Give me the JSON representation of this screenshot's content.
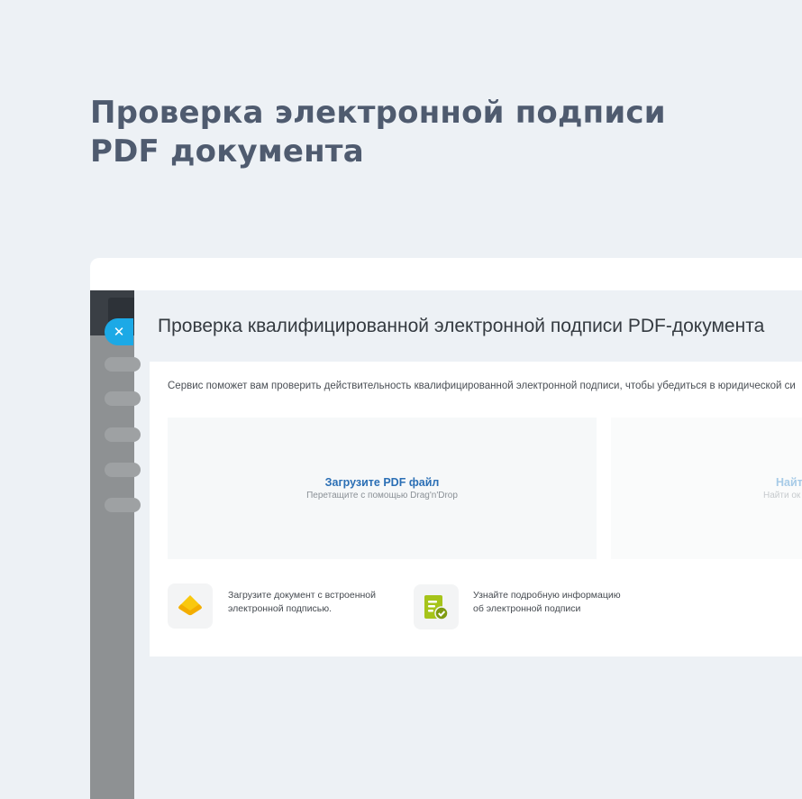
{
  "hero": {
    "title_line1": "Проверка электронной подписи",
    "title_line2": "PDF документа"
  },
  "app": {
    "close_glyph": "✕",
    "page_title": "Проверка квалифицированной электронной подписи PDF-документа",
    "description": "Сервис поможет вам проверить действительность квалифицированной электронной подписи, чтобы убедиться в юридической си",
    "upload": {
      "title": "Загрузите PDF файл",
      "hint": "Перетащите с помощью Drag'n'Drop"
    },
    "find": {
      "title": "Найт",
      "hint": "Найти ок"
    },
    "features": [
      {
        "icon": "upload-document-icon",
        "line1": "Загрузите документ с встроенной",
        "line2": "электронной подписью."
      },
      {
        "icon": "signature-info-icon",
        "line1": "Узнайте подробную информацию",
        "line2": "об электронной подписи"
      }
    ]
  },
  "colors": {
    "background": "#edf1f5",
    "hero_title": "#4f5b6f",
    "accent_blue": "#1ca9e6",
    "link_blue": "#2b6fb5",
    "icon_yellow": "#f9c80e",
    "icon_green": "#a6c41a"
  }
}
